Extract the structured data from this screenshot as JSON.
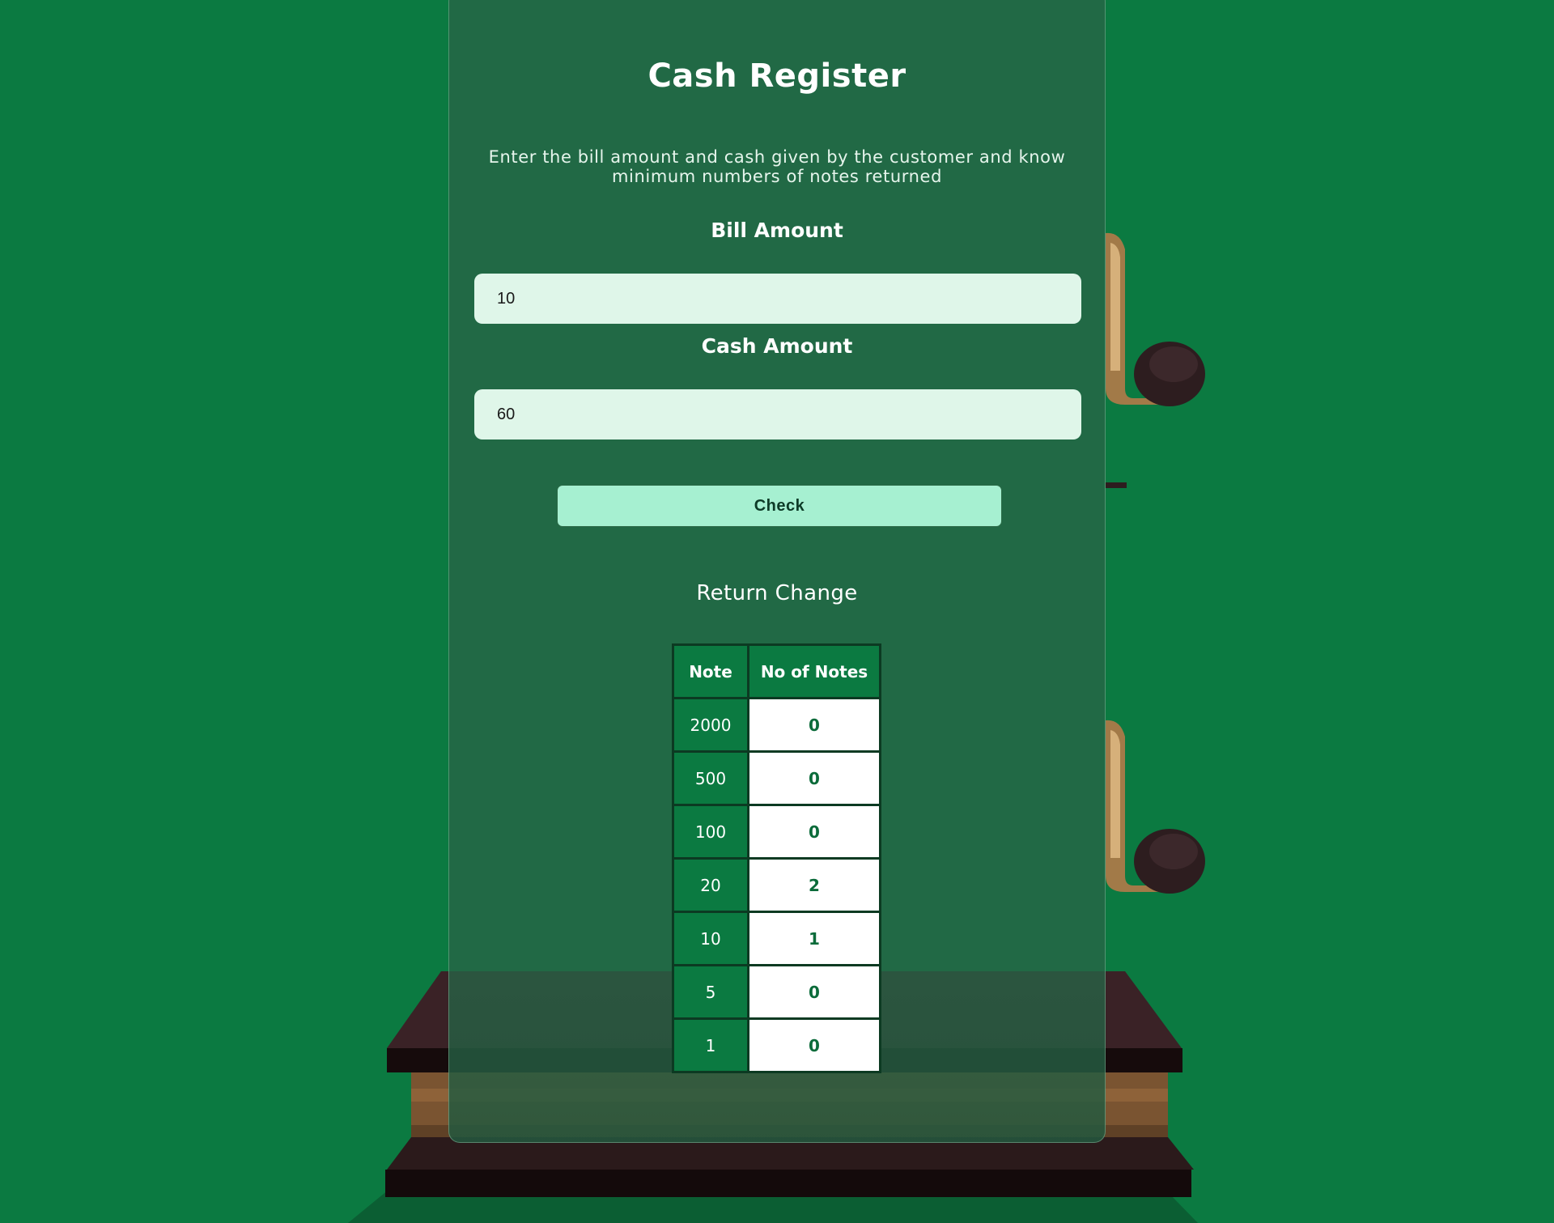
{
  "app": {
    "title": "Cash Register",
    "description": "Enter the bill amount and cash given by the customer and know minimum numbers of notes returned"
  },
  "form": {
    "bill_label": "Bill Amount",
    "bill_value": "10",
    "cash_label": "Cash Amount",
    "cash_value": "60",
    "check_label": "Check"
  },
  "result": {
    "title": "Return Change",
    "headers": [
      "Note",
      "No of Notes"
    ],
    "rows": [
      {
        "note": "2000",
        "count": "0"
      },
      {
        "note": "500",
        "count": "0"
      },
      {
        "note": "100",
        "count": "0"
      },
      {
        "note": "20",
        "count": "2"
      },
      {
        "note": "10",
        "count": "1"
      },
      {
        "note": "5",
        "count": "0"
      },
      {
        "note": "1",
        "count": "0"
      }
    ]
  },
  "colors": {
    "background": "#0b7a41",
    "accent": "#a6f0d1",
    "input_bg": "#dff6e9"
  },
  "icons": [
    "cash-register-illustration",
    "register-crank-handle"
  ]
}
